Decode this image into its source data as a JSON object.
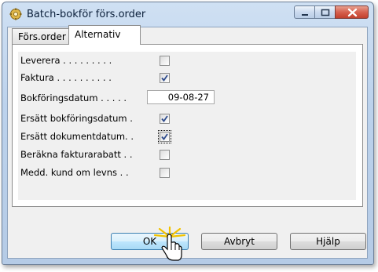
{
  "window": {
    "title": "Batch-bokför förs.order"
  },
  "tabs": [
    {
      "label": "Förs.order",
      "active": false
    },
    {
      "label": "Alternativ",
      "active": true
    }
  ],
  "options": [
    {
      "label": "Leverera . . . . . . . . .",
      "checked": false
    },
    {
      "label": "Faktura . . . . . . . . . .",
      "checked": true
    },
    {
      "label": "Bokföringsdatum . . . . .",
      "value": "09-08-27"
    },
    {
      "label": "Ersätt bokföringsdatum .",
      "checked": true
    },
    {
      "label": "Ersätt dokumentdatum. .",
      "checked": true,
      "focused": true
    },
    {
      "label": "Beräkna fakturarabatt . .",
      "checked": false
    },
    {
      "label": "Medd. kund om levns . .",
      "checked": false
    }
  ],
  "buttons": {
    "ok": "OK",
    "cancel": "Avbryt",
    "help": "Hjälp"
  },
  "colors": {
    "titlebar": "#bcd2ec",
    "close_button": "#d6604e",
    "ok_highlight": "#3c7fb1"
  }
}
